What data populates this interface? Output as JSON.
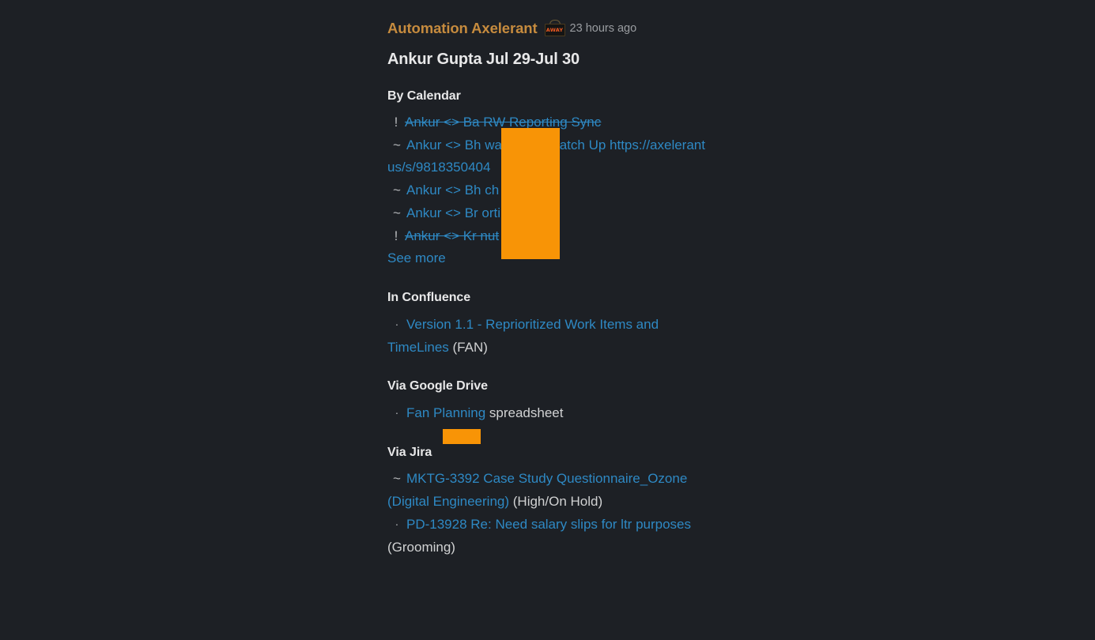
{
  "message": {
    "app_name": "Automation Axelerant",
    "status_badge": {
      "icon": "away-sign-icon",
      "label": "AWAY"
    },
    "timestamp": "23 hours ago",
    "title": "Ankur Gupta Jul 29-Jul 30"
  },
  "sections": [
    {
      "heading": "By Calendar",
      "items": [
        {
          "prefix": "!",
          "prefix_type": "bang",
          "struck": true,
          "link_text": "Ankur <> Ba          RW Reporting Sync",
          "trailing": ""
        },
        {
          "prefix": "~",
          "prefix_type": "tilde",
          "struck": false,
          "link_text": "Ankur <> Bh            war Donut Catch Up https://axelerant           us/s/9818350404",
          "trailing": ""
        },
        {
          "prefix": "~",
          "prefix_type": "tilde",
          "struck": false,
          "link_text": "Ankur <> Bh            ch Up",
          "trailing": ""
        },
        {
          "prefix": "~",
          "prefix_type": "tilde",
          "struck": false,
          "link_text": "Ankur <> Br           orting Sync",
          "trailing": ""
        },
        {
          "prefix": "!",
          "prefix_type": "bang",
          "struck": true,
          "link_text": "Ankur <> Kr            nut",
          "trailing": ""
        }
      ],
      "see_more": "See more"
    },
    {
      "heading": "In Confluence",
      "items": [
        {
          "prefix": "·",
          "prefix_type": "dot",
          "struck": false,
          "link_text": "Version 1.1 - Reprioritized Work Items and TimeLines",
          "trailing": " (FAN)"
        }
      ],
      "see_more": ""
    },
    {
      "heading": "Via Google Drive",
      "items": [
        {
          "prefix": "·",
          "prefix_type": "dot",
          "struck": false,
          "link_text": "Fan          Planning",
          "trailing": " spreadsheet"
        }
      ],
      "see_more": ""
    },
    {
      "heading": "Via Jira",
      "items": [
        {
          "prefix": "~",
          "prefix_type": "tilde",
          "struck": false,
          "link_text": "MKTG-3392 Case Study Questionnaire_Ozone (Digital Engineering)",
          "trailing": " (High/On Hold)"
        },
        {
          "prefix": "·",
          "prefix_type": "dot",
          "struck": false,
          "link_text": "PD-13928 Re: Need salary slips for ltr purposes",
          "trailing": " (Grooming)"
        }
      ],
      "see_more": ""
    }
  ],
  "redactions": [
    {
      "name": "calendar-redaction",
      "color": "#f89406"
    },
    {
      "name": "drive-redaction",
      "color": "#f89406"
    }
  ]
}
